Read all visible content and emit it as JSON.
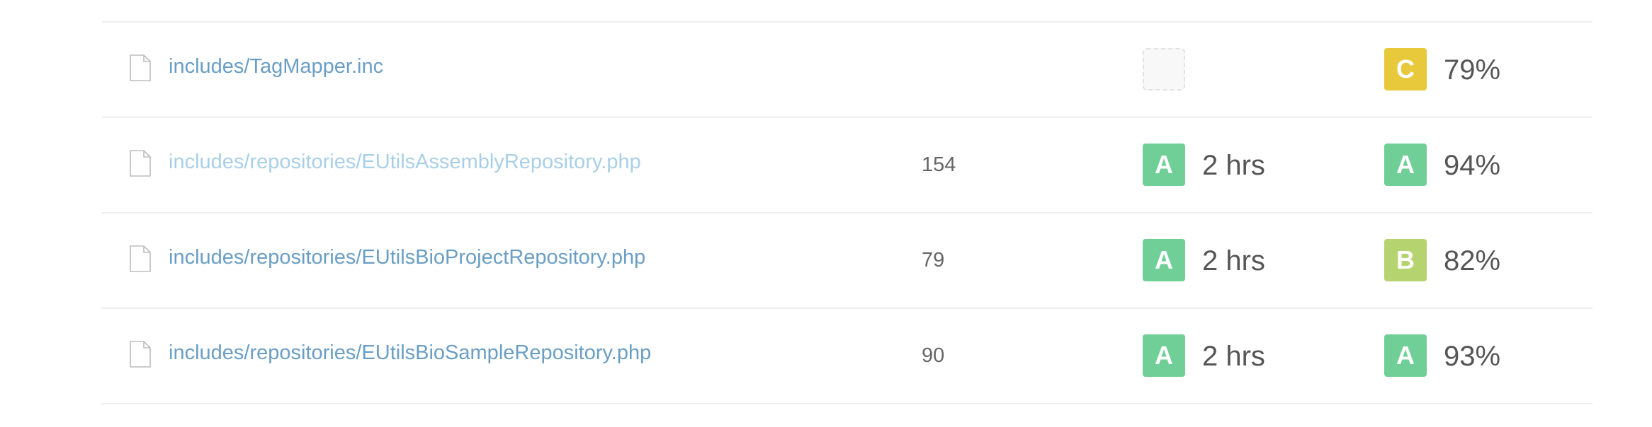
{
  "colors": {
    "grade_A": "#6fcf97",
    "grade_B": "#b5d46f",
    "grade_C": "#e8c93c",
    "link": "#6a9ec4",
    "link_light": "#a9cfe7",
    "divider": "#eeeeee"
  },
  "files": [
    {
      "icon": "file-icon",
      "path": "includes/TagMapper.inc",
      "lines": "",
      "maintainability": {
        "grade": "",
        "time": ""
      },
      "coverage": {
        "grade": "C",
        "percent": "79%"
      }
    },
    {
      "icon": "file-icon",
      "path": "includes/repositories/EUtilsAssemblyRepository.php",
      "lines": "154",
      "maintainability": {
        "grade": "A",
        "time": "2 hrs"
      },
      "coverage": {
        "grade": "A",
        "percent": "94%"
      }
    },
    {
      "icon": "file-icon",
      "path": "includes/repositories/EUtilsBioProjectRepository.php",
      "lines": "79",
      "maintainability": {
        "grade": "A",
        "time": "2 hrs"
      },
      "coverage": {
        "grade": "B",
        "percent": "82%"
      }
    },
    {
      "icon": "file-icon",
      "path": "includes/repositories/EUtilsBioSampleRepository.php",
      "lines": "90",
      "maintainability": {
        "grade": "A",
        "time": "2 hrs"
      },
      "coverage": {
        "grade": "A",
        "percent": "93%"
      }
    }
  ]
}
